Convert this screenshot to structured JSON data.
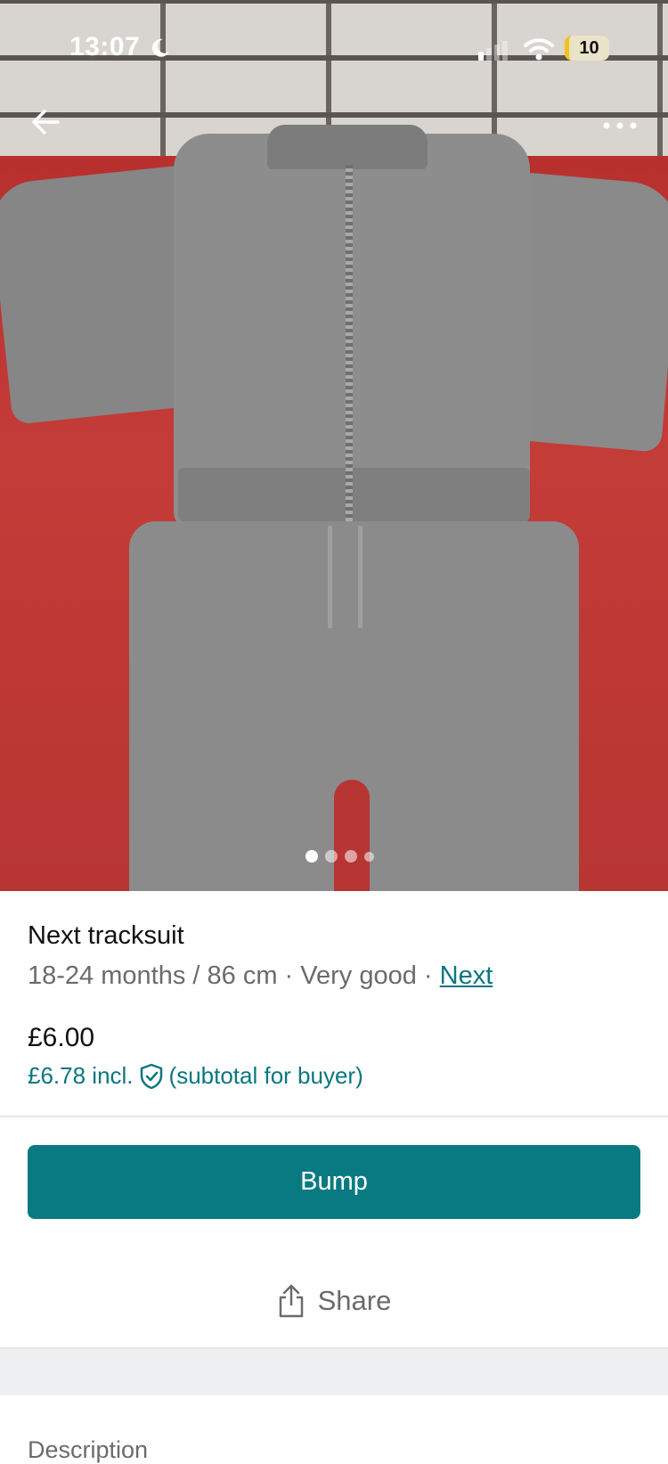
{
  "status_bar": {
    "time": "13:07",
    "battery": "10"
  },
  "photo": {
    "current_index": 1,
    "total": 4
  },
  "item": {
    "title": "Next tracksuit",
    "size": "18-24 months / 86 cm",
    "separator": " · ",
    "condition": "Very good",
    "brand": "Next",
    "price": "£6.00",
    "buyer_price": "£6.78 incl.",
    "buyer_note": "(subtotal for buyer)"
  },
  "actions": {
    "bump_label": "Bump",
    "share_label": "Share"
  },
  "sections": {
    "description_label": "Description"
  },
  "colors": {
    "accent": "#0a7a82",
    "link": "#0b7680"
  },
  "icons": [
    "back-arrow-icon",
    "more-options-icon",
    "moon-icon",
    "signal-icon",
    "wifi-icon",
    "shield-check-icon",
    "share-icon"
  ]
}
